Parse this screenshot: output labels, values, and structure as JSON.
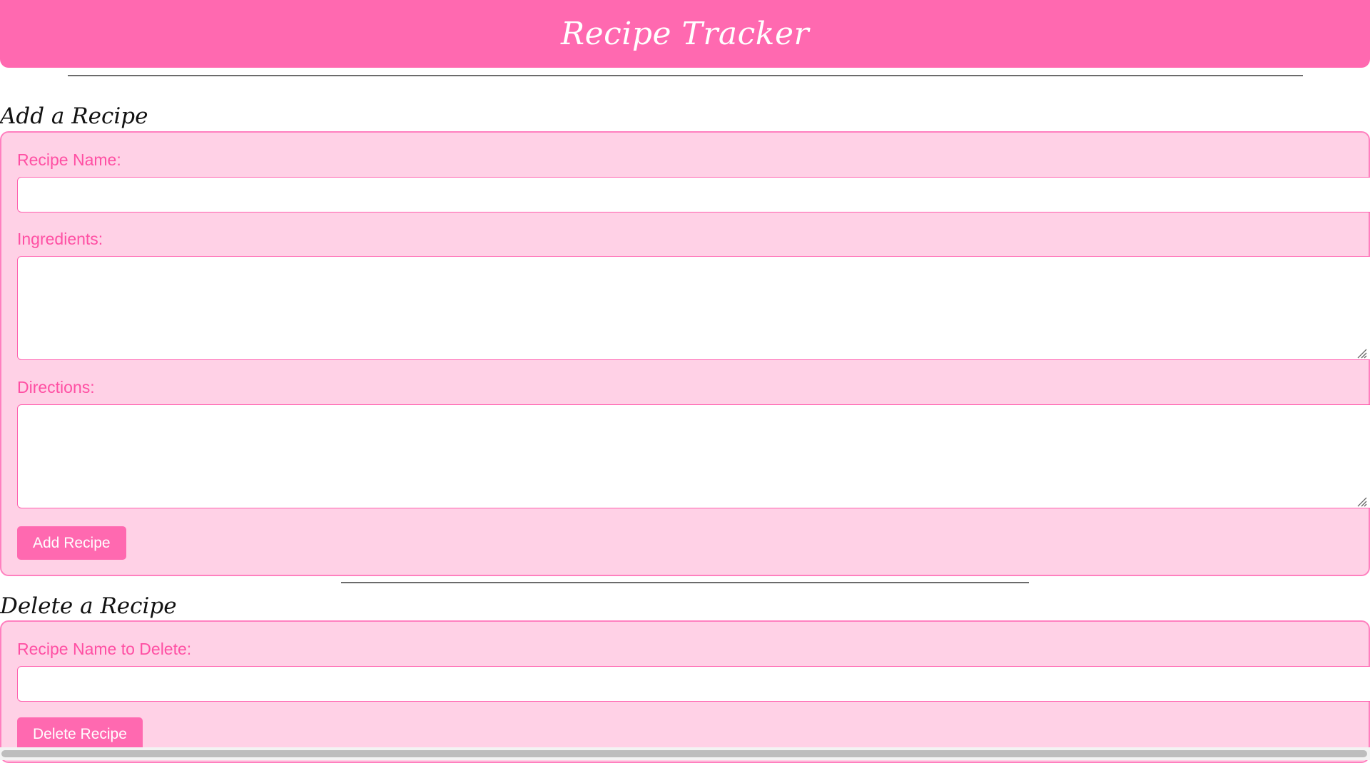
{
  "app": {
    "title": "Recipe Tracker"
  },
  "add_section": {
    "heading": "Add a Recipe",
    "recipe_name_label": "Recipe Name:",
    "recipe_name_value": "",
    "ingredients_label": "Ingredients:",
    "ingredients_value": "",
    "directions_label": "Directions:",
    "directions_value": "",
    "submit_label": "Add Recipe"
  },
  "delete_section": {
    "heading": "Delete a Recipe",
    "recipe_name_label": "Recipe Name to Delete:",
    "recipe_name_value": "",
    "submit_label": "Delete Recipe"
  },
  "colors": {
    "header_bg": "#ff69b0",
    "panel_bg": "#ffd1e6",
    "panel_border": "#ff80bf",
    "label_text": "#ff4fa3",
    "button_bg": "#ff69b0"
  },
  "icons": {
    "resize_handle": "resize-grip-icon"
  }
}
